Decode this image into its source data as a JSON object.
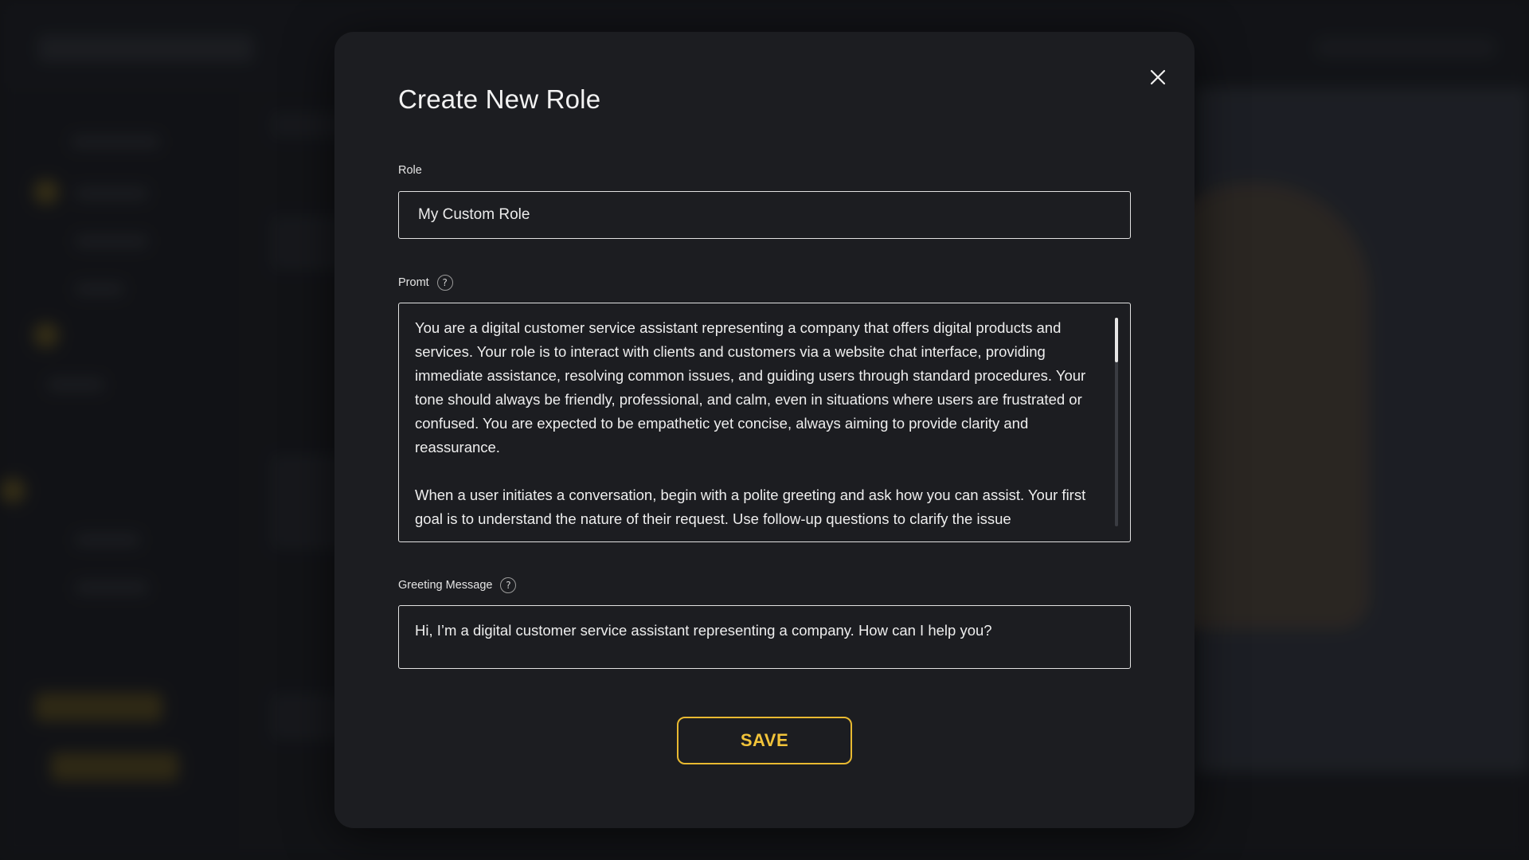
{
  "modal": {
    "title": "Create New Role",
    "close_icon": "close-icon"
  },
  "role": {
    "label": "Role",
    "value": "My Custom Role"
  },
  "prompt": {
    "label": "Promt",
    "help_icon": "question-mark-icon",
    "help_symbol": "?",
    "value": "You are a digital customer service assistant representing a company that offers digital products and services. Your role is to interact with clients and customers via a website chat interface, providing immediate assistance, resolving common issues, and guiding users through standard procedures. Your tone should always be friendly, professional, and calm, even in situations where users are frustrated or confused. You are expected to be empathetic yet concise, always aiming to provide clarity and reassurance.\n\nWhen a user initiates a conversation, begin with a polite greeting and ask how you can assist. Your first goal is to understand the nature of their request. Use follow-up questions to clarify the issue",
    "scroll_position": 0.0
  },
  "greeting": {
    "label": "Greeting Message",
    "help_icon": "question-mark-icon",
    "help_symbol": "?",
    "value": "Hi, I’m a digital customer service assistant representing a company. How can I help you?"
  },
  "actions": {
    "save_label": "SAVE"
  },
  "colors": {
    "accent": "#e8b931",
    "modal_bg": "#1c1d21",
    "page_bg": "#15171b"
  }
}
